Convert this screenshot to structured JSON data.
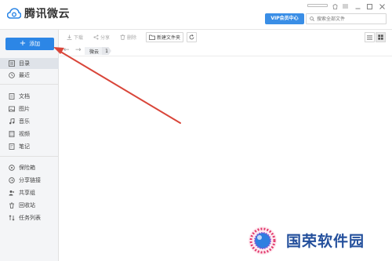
{
  "app": {
    "title": "腾讯微云"
  },
  "header": {
    "vip_label": "VIP会员中心",
    "search_placeholder": "搜索全部文件"
  },
  "sidebar": {
    "add_label": "添加",
    "groups": [
      [
        {
          "label": "目录",
          "icon": "directory-icon",
          "active": true
        },
        {
          "label": "最近",
          "icon": "clock-icon",
          "active": false
        }
      ],
      [
        {
          "label": "文档",
          "icon": "document-icon"
        },
        {
          "label": "图片",
          "icon": "image-icon"
        },
        {
          "label": "音乐",
          "icon": "music-icon"
        },
        {
          "label": "视频",
          "icon": "video-icon"
        },
        {
          "label": "笔记",
          "icon": "note-icon"
        }
      ],
      [
        {
          "label": "保险箱",
          "icon": "safe-icon"
        },
        {
          "label": "分享链接",
          "icon": "share-link-icon"
        },
        {
          "label": "共享组",
          "icon": "share-group-icon"
        },
        {
          "label": "回收站",
          "icon": "recycle-icon"
        },
        {
          "label": "任务列表",
          "icon": "task-list-icon"
        }
      ]
    ]
  },
  "toolbar": {
    "download_label": "下载",
    "share_label": "分享",
    "delete_label": "删除",
    "new_folder_label": "新建文件夹"
  },
  "pathbar": {
    "crumb": "微云",
    "count": "1"
  },
  "watermark": {
    "text": "国荣软件园"
  },
  "colors": {
    "accent": "#2c86e6",
    "vip": "#3a8ee6",
    "arrow": "#d9463a",
    "watermark": "#234f9c"
  }
}
